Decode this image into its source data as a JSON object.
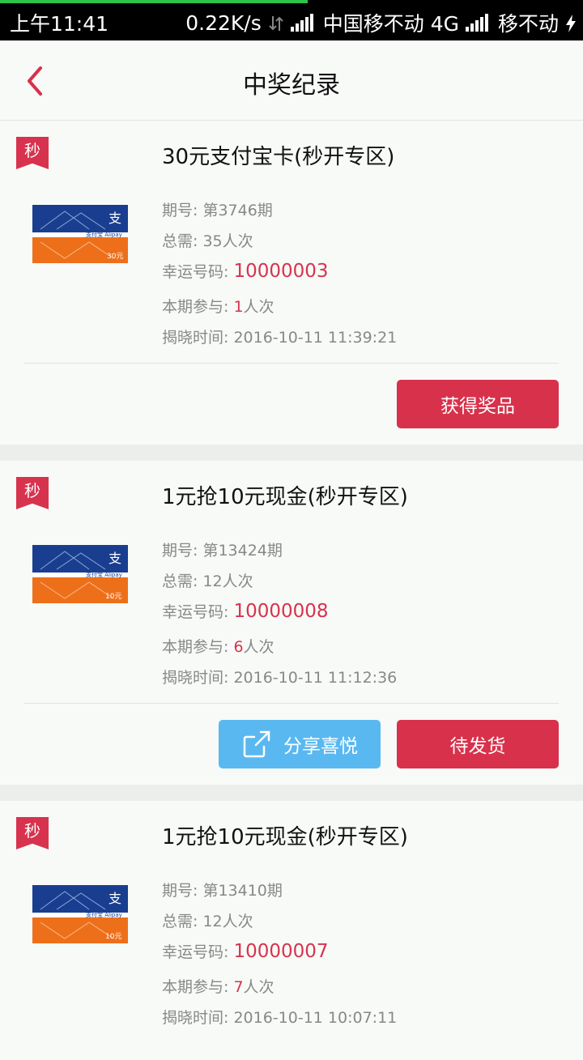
{
  "status_bar": {
    "time": "上午11:41",
    "net_speed": "0.22K/s",
    "carrier1": "中国移不动 4G",
    "carrier2": "移不动"
  },
  "header": {
    "title": "中奖纪录"
  },
  "labels": {
    "issue": "期号: ",
    "total": "总需: ",
    "lucky": "幸运号码: ",
    "join": "本期参与: ",
    "join_unit": "人次",
    "reveal": "揭晓时间: "
  },
  "records": [
    {
      "badge": "秒",
      "name": "30元支付宝卡(秒开专区)",
      "card_value": "30元",
      "issue": "第3746期",
      "total": "35人次",
      "lucky_no": "10000003",
      "join_count": "1",
      "reveal_time": "2016-10-11 11:39:21",
      "btn_primary": "获得奖品"
    },
    {
      "badge": "秒",
      "name": "1元抢10元现金(秒开专区)",
      "card_value": "10元",
      "issue": "第13424期",
      "total": "12人次",
      "lucky_no": "10000008",
      "join_count": "6",
      "reveal_time": "2016-10-11 11:12:36",
      "btn_share": "分享喜悦",
      "btn_primary": "待发货"
    },
    {
      "badge": "秒",
      "name": "1元抢10元现金(秒开专区)",
      "card_value": "10元",
      "issue": "第13410期",
      "total": "12人次",
      "lucky_no": "10000007",
      "join_count": "7",
      "reveal_time": "2016-10-11 10:07:11"
    }
  ],
  "colors": {
    "accent": "#d8314b",
    "share": "#5ab8f0",
    "alipay_blue": "#1a3e8f",
    "alipay_orange": "#ee6f1a"
  }
}
